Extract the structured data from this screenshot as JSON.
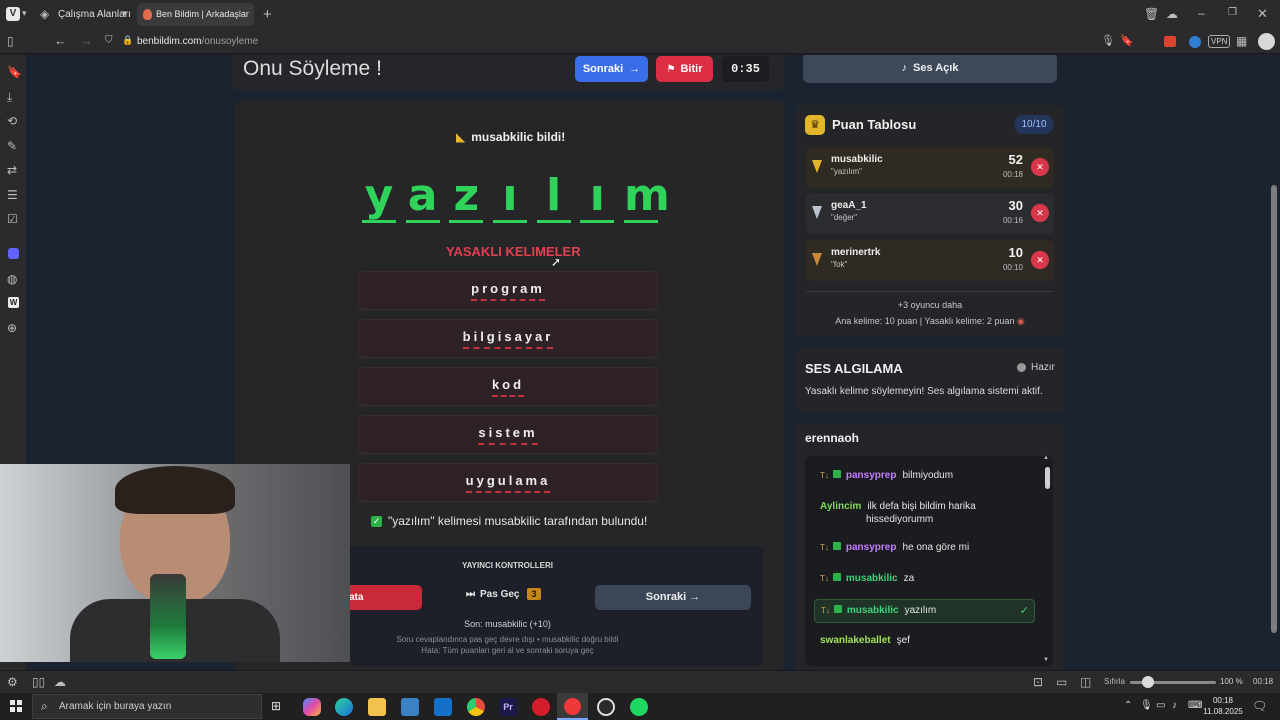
{
  "browser": {
    "workspace_label": "Çalışma Alanları",
    "tab_title": "Ben Bildim | Arkadaşlarınla",
    "url_host": "benbildim.com",
    "url_path": "/onusoyleme",
    "vpn_label": "VPN"
  },
  "game": {
    "title": "Onu Söyleme !",
    "next_label": "Sonraki",
    "next_arrow": "→",
    "finish_label": "Bitir",
    "timer": "0:35",
    "sound_label": "Ses Açık",
    "guessed_banner": "musabkilic bildi!",
    "word_letters": [
      "y",
      "a",
      "z",
      "ı",
      "l",
      "ı",
      "m"
    ],
    "forbidden_title": "YASAKLI KELIMELER",
    "forbidden_words": [
      "program",
      "bilgisayar",
      "kod",
      "sistem",
      "uygulama"
    ],
    "found_message": "\"yazılım\" kelimesi musabkilic tarafından bulundu!"
  },
  "host_controls": {
    "title": "YAYINCI KONTROLLERI",
    "error_btn": "ata",
    "pass_label": "Pas Geç",
    "pass_count": "3",
    "next_label": "Sonraki →",
    "last": "Son: musabkilic (+10)",
    "info1": "Soru cevaplandınca pas geç devre dışı • musabkilic doğru bildi",
    "info2": "Hata: Tüm puanları geri al ve sonraki soruya geç"
  },
  "leaderboard": {
    "title": "Puan Tablosu",
    "count": "10/10",
    "players": [
      {
        "name": "musabkilic",
        "word": "\"yazılım\"",
        "score": "52",
        "time": "00:18"
      },
      {
        "name": "geaA_1",
        "word": "\"değer\"",
        "score": "30",
        "time": "00:16"
      },
      {
        "name": "merinertrk",
        "word": "\"fok\"",
        "score": "10",
        "time": "00:10"
      }
    ],
    "more": "+3 oyuncu daha",
    "rules": "Ana kelime: 10 puan | Yasaklı kelime: 2 puan"
  },
  "voice": {
    "title": "SES ALGILAMA",
    "status": "Hazır",
    "desc": "Yasaklı kelime söylemeyin! Ses algılama sistemi aktif."
  },
  "chat": {
    "channel": "erennaoh",
    "messages": [
      {
        "user": "pansyprep",
        "text": "bilmiyodum",
        "color": "#c77dff"
      },
      {
        "user": "Aylincim",
        "text": "ilk defa bişi bildim harika",
        "text2": "hissediyorumm",
        "color": "#7ed957"
      },
      {
        "user": "pansyprep",
        "text": "he ona göre mi",
        "color": "#c77dff"
      },
      {
        "user": "musabkilic",
        "text": "za",
        "color": "#3fd07a"
      },
      {
        "user": "musabkilic",
        "text": "yazılım",
        "color": "#3fd07a"
      },
      {
        "user": "swanlakeballet",
        "text": "şef",
        "color": "#a3e05a"
      }
    ]
  },
  "statusbar": {
    "reset_label": "Sıfırla",
    "zoom": "100 %",
    "clock": "00:18"
  },
  "taskbar": {
    "search_placeholder": "Aramak için buraya yazın",
    "time": "00:18",
    "date": "11.08.2025"
  }
}
